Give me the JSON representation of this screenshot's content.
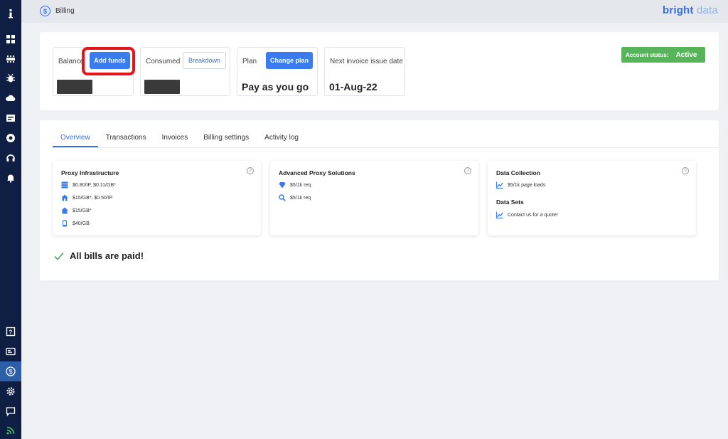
{
  "breadcrumb": {
    "icon": "dollar-icon",
    "label": "Billing"
  },
  "brand": {
    "part1": "bright",
    "part2": " data"
  },
  "sidebar": {
    "top_items": [
      "info-icon",
      "dashboard-icon",
      "network-icon",
      "bug-icon",
      "cloud-api-icon",
      "serp-icon",
      "proxy-icon",
      "headset-icon",
      "bell-icon"
    ],
    "bottom_items": [
      "help-icon",
      "id-card-icon",
      "billing-icon",
      "settings-icon",
      "chat-icon",
      "rss-icon"
    ],
    "active": "billing-icon"
  },
  "balance": {
    "label": "Balance",
    "button": "Add funds"
  },
  "consumed": {
    "label": "Consumed",
    "button": "Breakdown"
  },
  "plan": {
    "label": "Plan",
    "button": "Change plan",
    "value": "Pay as you go"
  },
  "invoice": {
    "label": "Next invoice issue date",
    "value": "01-Aug-22"
  },
  "account_status": {
    "label": "Account status:",
    "value": "Active"
  },
  "tabs": [
    "Overview",
    "Transactions",
    "Invoices",
    "Billing settings",
    "Activity log"
  ],
  "active_tab": "Overview",
  "proxy_infra": {
    "title": "Proxy Infrastructure",
    "rows": [
      "$0.80/IP, $0.11/GB*",
      "$15/GB*, $0.50/IP",
      "$15/GB*",
      "$40/GB"
    ]
  },
  "advanced_proxy": {
    "title": "Advanced Proxy Solutions",
    "rows": [
      "$5/1k req",
      "$5/1k req"
    ]
  },
  "data_collection": {
    "title": "Data Collection",
    "rows": [
      "$5/1k page loads"
    ],
    "datasets_title": "Data Sets",
    "datasets_rows": [
      "Contact us for a quote!"
    ]
  },
  "help_symbol": "?",
  "bills_status": "All bills are paid!",
  "colors": {
    "sidebar": "#0f1f44",
    "accent": "#3a7bf0",
    "status_green": "#57b45a",
    "highlight": "#e8121c"
  }
}
